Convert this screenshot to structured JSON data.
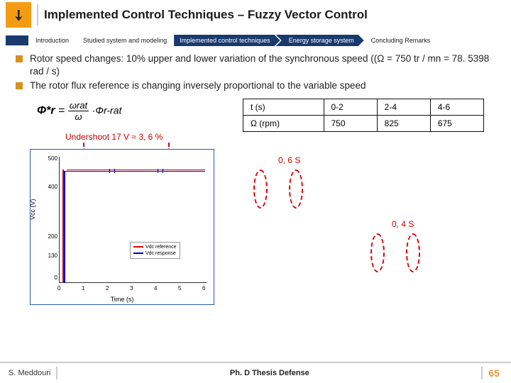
{
  "title": "Implemented Control Techniques – Fuzzy Vector Control",
  "nav": {
    "items": [
      "Introduction",
      "Studied system and modeling",
      "Implemented control techniques",
      "Energy storage system",
      "Concluding Remarks"
    ]
  },
  "bullets": [
    "Rotor speed changes: 10% upper and lower variation of the synchronous speed ((Ω = 750 tr / mn = 78. 5398 rad / s)",
    "The rotor flux reference is changing inversely proportional to the variable speed"
  ],
  "formula": {
    "lhs": "Φ*r",
    "eq": "=",
    "num": "ωrat",
    "den": "ω",
    "suffix": "·Φr-rat"
  },
  "undershoot": "Undershoot 17 V ≈ 3, 6 %",
  "table": {
    "rows": [
      [
        "t (s)",
        "0-2",
        "2-4",
        "4-6"
      ],
      [
        "Ω (rpm)",
        "750",
        "825",
        "675"
      ]
    ]
  },
  "regions": {
    "r1": "0, 6 S",
    "r2": "0, 4 S"
  },
  "chart_data": {
    "type": "line",
    "title": "",
    "xlabel": "Time (s)",
    "ylabel": "Vcc (V)",
    "xlim": [
      0,
      6
    ],
    "ylim": [
      0,
      550
    ],
    "x_ticks": [
      0,
      1,
      2,
      3,
      4,
      5,
      6
    ],
    "y_ticks": [
      0,
      130,
      200,
      400,
      500
    ],
    "series": [
      {
        "name": "Vdc reference",
        "color": "#d00",
        "x": [
          0,
          0.3,
          0.4,
          6
        ],
        "y": [
          0,
          0,
          460,
          460
        ]
      },
      {
        "name": "Vdc response",
        "color": "#00c",
        "x": [
          0,
          0.3,
          0.5,
          0.7,
          2,
          2.05,
          2.3,
          4,
          4.05,
          4.3,
          6
        ],
        "y": [
          0,
          0,
          443,
          460,
          460,
          450,
          460,
          460,
          445,
          460,
          460
        ]
      }
    ],
    "legend": [
      "Vdc reference",
      "Vdc response"
    ]
  },
  "footer": {
    "author": "S. Meddouri",
    "center": "Ph. D Thesis Defense",
    "page": "65"
  }
}
